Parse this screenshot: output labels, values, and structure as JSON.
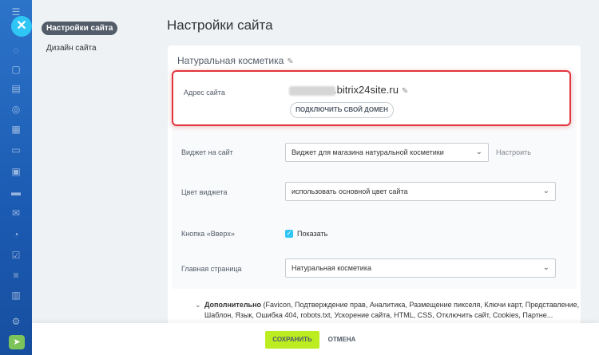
{
  "rail": {
    "menu_icon": "☰",
    "close_icon": "✕",
    "icons": [
      "chat-icon",
      "feed-icon",
      "tasks-icon",
      "crm-icon",
      "calendar-icon",
      "docs-icon",
      "sites-icon",
      "store-icon",
      "mail-icon",
      "contacts-icon",
      "approvals-icon",
      "automation-icon",
      "reports-icon",
      "settings-icon"
    ],
    "bottom_icon": "➤"
  },
  "nav": {
    "items": [
      {
        "label": "Настройки сайта",
        "active": true
      },
      {
        "label": "Дизайн сайта",
        "active": false
      }
    ]
  },
  "page": {
    "title": "Настройки сайта"
  },
  "card": {
    "title": "Натуральная косметика",
    "address_label": "Адрес сайта",
    "address_value": ".bitrix24site.ru",
    "connect_domain_label": "ПОДКЛЮЧИТЬ СВОЙ ДОМЕН",
    "widget_label": "Виджет на сайт",
    "widget_value": "Виджет для магазина натуральной косметики",
    "configure_label": "Настроить",
    "widget_color_label": "Цвет виджета",
    "widget_color_value": "использовать основной цвет сайта",
    "up_button_label": "Кнопка «Вверх»",
    "show_label": "Показать",
    "show_checked": true,
    "home_page_label": "Главная страница",
    "home_page_value": "Натуральная косметика"
  },
  "more": {
    "title": "Дополнительно",
    "items": "(Favicon, Подтверждение прав, Аналитика, Размещение пикселя, Ключи карт, Представление, Шаблон, Язык, Ошибка 404, robots.txt, Ускорение сайта, HTML, CSS, Отключить сайт, Cookies, Партне..."
  },
  "footer": {
    "save_label": "СОХРАНИТЬ",
    "cancel_label": "ОТМЕНА"
  },
  "colors": {
    "accent": "#2fc6f6",
    "save": "#bbed21",
    "highlight": "#e0353c"
  }
}
